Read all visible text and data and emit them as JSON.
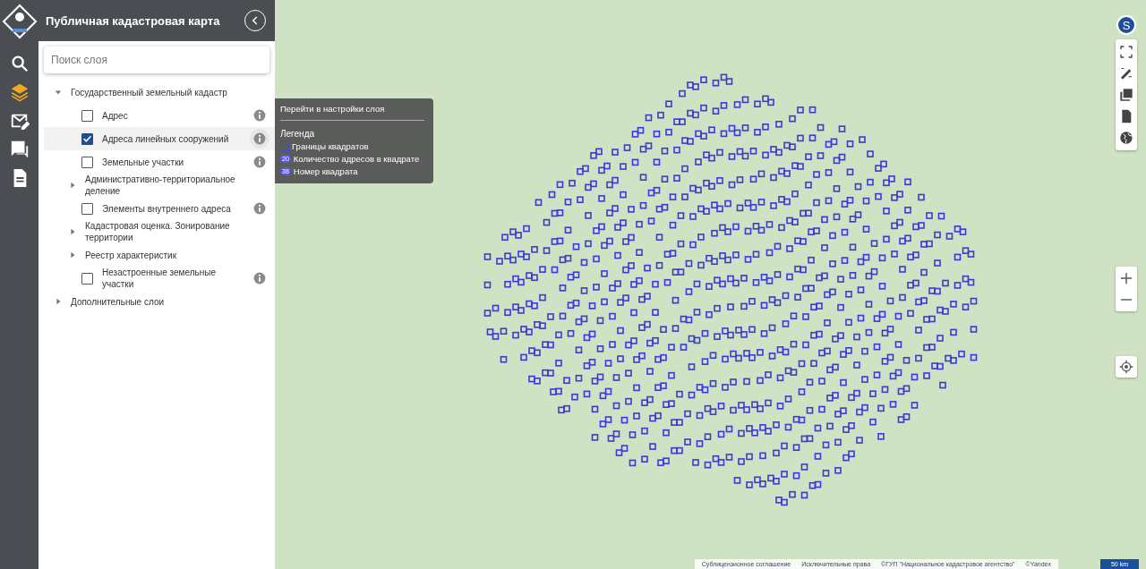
{
  "header": {
    "title": "Публичная кадастровая карта"
  },
  "rail": [
    {
      "kind": "search",
      "selected": false
    },
    {
      "kind": "layers",
      "selected": true
    },
    {
      "kind": "mail",
      "selected": false
    },
    {
      "kind": "feedback",
      "selected": false
    },
    {
      "kind": "document",
      "selected": false
    }
  ],
  "search": {
    "placeholder": "Поиск слоя"
  },
  "tree": [
    {
      "kind": "group",
      "label": "Государственный земельный кадастр",
      "expanded": true,
      "children": [
        {
          "kind": "layer",
          "label": "Адрес",
          "checked": false,
          "selected": false
        },
        {
          "kind": "layer",
          "label": "Адреса линейных сооружений",
          "checked": true,
          "selected": true
        },
        {
          "kind": "layer",
          "label": "Земельные участки",
          "checked": false,
          "selected": false
        },
        {
          "kind": "group",
          "label": "Административно-территориальное деление",
          "expanded": false
        },
        {
          "kind": "layer",
          "label": "Элементы внутреннего адреса",
          "checked": false,
          "selected": false
        },
        {
          "kind": "group",
          "label": "Кадастровая оценка. Зонирование территории",
          "expanded": false
        },
        {
          "kind": "group",
          "label": "Реестр характеристик",
          "expanded": false
        },
        {
          "kind": "layer",
          "label": "Незастроенные земельные участки",
          "checked": false,
          "selected": false
        }
      ]
    },
    {
      "kind": "group",
      "label": "Дополнительные слои",
      "expanded": false
    }
  ],
  "tooltip": {
    "link": "Перейти в настройки слоя",
    "legend_title": "Легенда",
    "legend": [
      {
        "kind": "square",
        "label": "Границы квадратов"
      },
      {
        "kind": "count",
        "badge": "20",
        "label": "Количество адресов в квадрате"
      },
      {
        "kind": "number",
        "badge": "38",
        "label": "Номер квадрата"
      }
    ]
  },
  "map_controls": {
    "user_initial": "S"
  },
  "attribution": [
    "Сублицензионное соглашение",
    "Исключительные права",
    "©ГУП \"Национальное кадастровое агентство\"",
    "©Yandex"
  ],
  "scale": "50 km"
}
